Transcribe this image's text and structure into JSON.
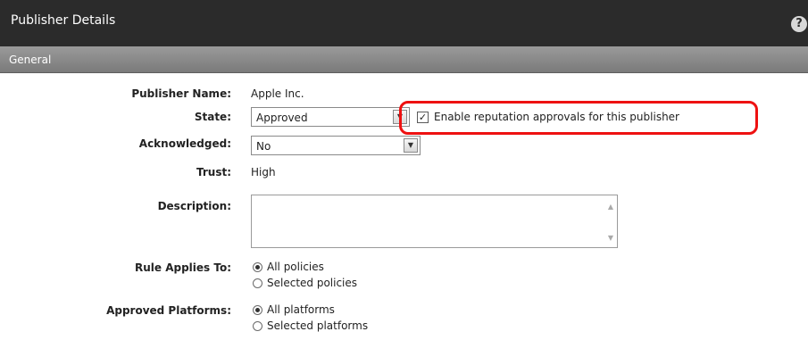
{
  "header": {
    "title": "Publisher Details",
    "help_icon": "?"
  },
  "section": {
    "title": "General"
  },
  "form": {
    "publisher_name": {
      "label": "Publisher Name:",
      "value": "Apple Inc."
    },
    "state": {
      "label": "State:",
      "selected": "Approved",
      "checkbox_checked": true,
      "checkbox_label": "Enable reputation approvals for this publisher"
    },
    "acknowledged": {
      "label": "Acknowledged:",
      "selected": "No"
    },
    "trust": {
      "label": "Trust:",
      "value": "High"
    },
    "description": {
      "label": "Description:",
      "value": ""
    },
    "rule_applies_to": {
      "label": "Rule Applies To:",
      "options": [
        "All policies",
        "Selected policies"
      ],
      "selected_index": 0
    },
    "approved_platforms": {
      "label": "Approved Platforms:",
      "options": [
        "All platforms",
        "Selected platforms"
      ],
      "selected_index": 0
    }
  },
  "colors": {
    "header_bg": "#2b2b2b",
    "section_bg": "#8a8a8a",
    "highlight": "#ee1111"
  }
}
